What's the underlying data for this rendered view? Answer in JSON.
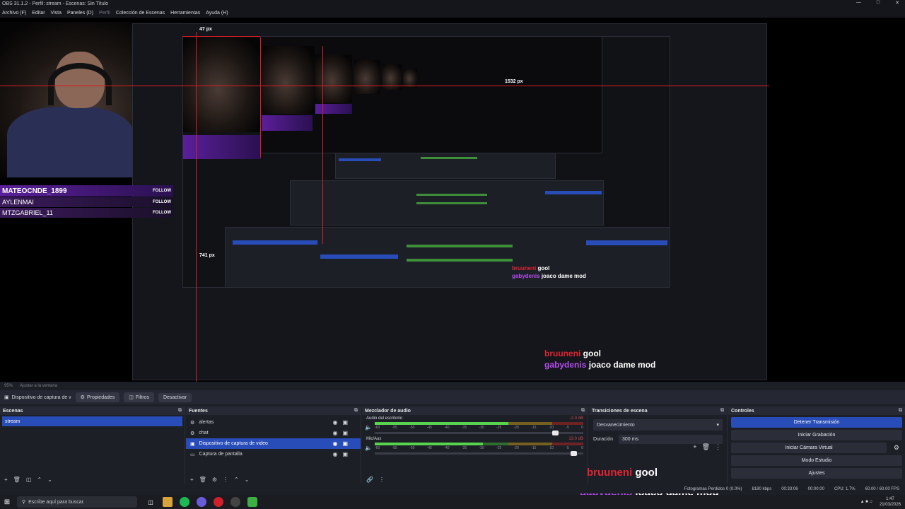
{
  "window": {
    "title": "OBS 31.1.2 - Perfil: stream - Escenas: Sin Título"
  },
  "menu": [
    "Archivo (F)",
    "Editar",
    "Vista",
    "Paneles (D)",
    "Perfil",
    "Colección de Escenas",
    "Herramientas",
    "Ayuda (H)"
  ],
  "preview": {
    "followers": [
      {
        "user": "MATEOCNDE_1899",
        "button": "FOLLOW"
      },
      {
        "user": "AYLENMAI",
        "button": "FOLLOW"
      },
      {
        "user": "MTZGABRIEL_11",
        "button": "FOLLOW"
      }
    ],
    "px_label_w": "1532 px",
    "px_label_h": "741 px",
    "px_label_small": "47 px",
    "chat": [
      {
        "user": "bruuneni",
        "text": "gool"
      },
      {
        "user": "gabydenis",
        "text": "joaco dame mod"
      }
    ]
  },
  "subbar": {
    "zoom": "95%",
    "fit": "Ajustar a la ventana"
  },
  "sourcebar": {
    "source_name": "Dispositivo de captura de v",
    "properties": "Propiedades",
    "filters": "Filtros",
    "deactivate": "Desactivar"
  },
  "docks": {
    "scenes": {
      "title": "Escenas",
      "items": [
        "stream"
      ]
    },
    "sources": {
      "title": "Fuentes",
      "items": [
        "alertas",
        "chat",
        "Dispositivo de captura de video",
        "Captura de pantalla"
      ]
    },
    "mixer": {
      "title": "Mezclador de audio",
      "channels": [
        {
          "name": "Audio del escritorio",
          "db": "-2.0 dB"
        },
        {
          "name": "Mic/Aux",
          "db": "13.0 dB"
        }
      ],
      "scale": [
        "-60",
        "-55",
        "-50",
        "-45",
        "-40",
        "-35",
        "-30",
        "-25",
        "-20",
        "-15",
        "-10",
        "-5",
        "0"
      ]
    },
    "transitions": {
      "title": "Transiciones de escena",
      "type": "Desvanecimiento",
      "duration_label": "Duración",
      "duration_value": "300 ms"
    },
    "controls": {
      "title": "Controles",
      "buttons": [
        "Detener Transmisión",
        "Iniciar Grabación",
        "Iniciar Cámara Virtual",
        "Modo Estudio",
        "Ajustes"
      ]
    }
  },
  "status": {
    "dropped": "Fotogramas Perdidos 0 (0.0%)",
    "bitrate": "8180 kbps",
    "stream_time": "00:33:06",
    "rec_time": "00:00:00",
    "cpu": "CPU: 1.7%",
    "fps": "60.00 / 60.00 FPS"
  },
  "taskbar": {
    "search_placeholder": "Escribe aquí para buscar.",
    "time": "1:47",
    "date": "21/03/2026"
  },
  "colors": {
    "accent": "#284cb8",
    "follow_purple": "#5a1f9a",
    "chat_red": "#e02434",
    "chat_purple": "#b44cf0",
    "meter_green": "#58d34d"
  },
  "meters": {
    "desktop_level": 0.64,
    "mic_level": 0.52,
    "desktop_fader": 0.88,
    "mic_fader": 0.97
  }
}
